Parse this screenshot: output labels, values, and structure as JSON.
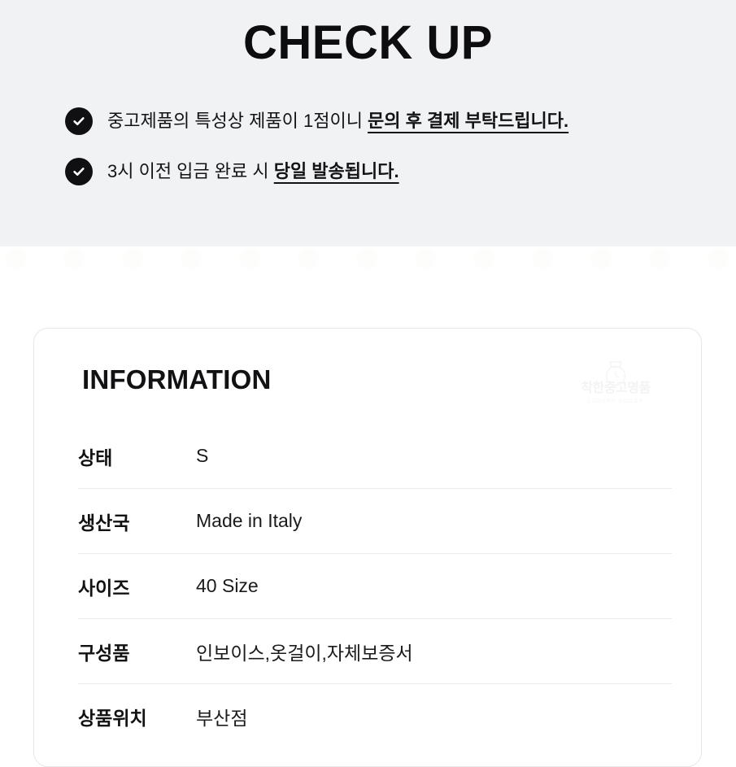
{
  "theme": {
    "band_bg": "#f1f2f4",
    "page_bg": "#ffffff",
    "text": "#121214",
    "icon_bg": "#101012",
    "divider": "#ebebed",
    "card_border": "#e7e7e9"
  },
  "checkup": {
    "title": "CHECK UP",
    "bullets": [
      {
        "icon": "check-circle-icon",
        "plain": "중고제품의 특성상 제품이 1점이니 ",
        "emphasis": "문의 후 결제 부탁드립니다."
      },
      {
        "icon": "check-circle-icon",
        "plain": "3시 이전 입금 완료 시 ",
        "emphasis": "당일 발송됩니다."
      }
    ]
  },
  "information": {
    "title": "INFORMATION",
    "watermark": {
      "icon": "watch-icon",
      "brand": "착한중고명품",
      "subtitle": "LUXURY GOODS"
    },
    "rows": [
      {
        "label": "상태",
        "value": "S"
      },
      {
        "label": "생산국",
        "value": "Made in Italy"
      },
      {
        "label": "사이즈",
        "value": "40 Size"
      },
      {
        "label": "구성품",
        "value": "인보이스,옷걸이,자체보증서"
      },
      {
        "label": "상품위치",
        "value": "부산점"
      }
    ]
  }
}
